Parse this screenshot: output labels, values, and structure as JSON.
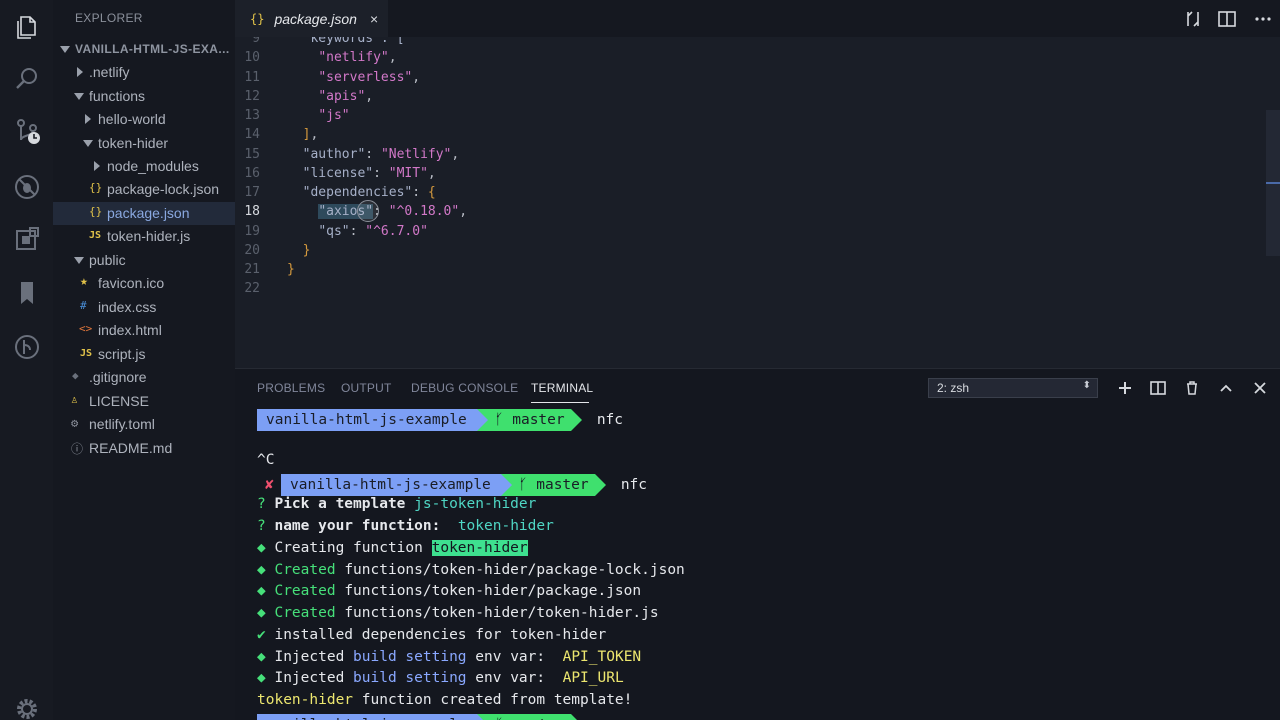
{
  "sidebar": {
    "title": "EXPLORER",
    "root": "VANILLA-HTML-JS-EXA...",
    "items": [
      {
        "label": ".netlify",
        "type": "folder",
        "state": "closed",
        "depth": 1
      },
      {
        "label": "functions",
        "type": "folder",
        "state": "open",
        "depth": 1
      },
      {
        "label": "hello-world",
        "type": "folder",
        "state": "closed",
        "depth": 2
      },
      {
        "label": "token-hider",
        "type": "folder",
        "state": "open",
        "depth": 2
      },
      {
        "label": "node_modules",
        "type": "folder",
        "state": "closed",
        "depth": 3
      },
      {
        "label": "package-lock.json",
        "type": "json",
        "depth": 3
      },
      {
        "label": "package.json",
        "type": "json",
        "depth": 3,
        "selected": true
      },
      {
        "label": "token-hider.js",
        "type": "js",
        "depth": 3
      },
      {
        "label": "public",
        "type": "folder",
        "state": "open",
        "depth": 1
      },
      {
        "label": "favicon.ico",
        "type": "ico",
        "depth": 2
      },
      {
        "label": "index.css",
        "type": "css",
        "depth": 2
      },
      {
        "label": "index.html",
        "type": "html",
        "depth": 2
      },
      {
        "label": "script.js",
        "type": "js",
        "depth": 2
      },
      {
        "label": ".gitignore",
        "type": "git",
        "depth": 1
      },
      {
        "label": "LICENSE",
        "type": "license",
        "depth": 1
      },
      {
        "label": "netlify.toml",
        "type": "toml",
        "depth": 1
      },
      {
        "label": "README.md",
        "type": "md",
        "depth": 1
      }
    ]
  },
  "editor": {
    "tab_icon": "{}",
    "tab_label": "package.json",
    "tab_close": "×",
    "lines": [
      {
        "n": "9",
        "code": "  \"keywords\": ["
      },
      {
        "n": "10",
        "code": "    \"netlify\","
      },
      {
        "n": "11",
        "code": "    \"serverless\","
      },
      {
        "n": "12",
        "code": "    \"apis\","
      },
      {
        "n": "13",
        "code": "    \"js\""
      },
      {
        "n": "14",
        "code": "  ],"
      },
      {
        "n": "15",
        "code": "  \"author\": \"Netlify\","
      },
      {
        "n": "16",
        "code": "  \"license\": \"MIT\","
      },
      {
        "n": "17",
        "code": "  \"dependencies\": {"
      },
      {
        "n": "18",
        "code": "    \"axios\": \"^0.18.0\","
      },
      {
        "n": "19",
        "code": "    \"qs\": \"^6.7.0\""
      },
      {
        "n": "20",
        "code": "  }"
      },
      {
        "n": "21",
        "code": "}"
      },
      {
        "n": "22",
        "code": ""
      }
    ]
  },
  "panel": {
    "tabs": [
      "PROBLEMS",
      "OUTPUT",
      "DEBUG CONSOLE",
      "TERMINAL"
    ],
    "active_tab": "TERMINAL",
    "shell_select": "2: zsh",
    "prompt_path": "vanilla-html-js-example",
    "prompt_branch": "master",
    "cmd": "nfc",
    "ctrl_c": "^C",
    "err_mark": "✘",
    "q_mark": "?",
    "pick_label": "Pick a template",
    "pick_value": "js-token-hider",
    "name_label": "name your function:",
    "name_value": "token-hider",
    "diamond": "◆",
    "creating": "Creating function",
    "created": "Created",
    "file1": "functions/token-hider/package-lock.json",
    "file2": "functions/token-hider/package.json",
    "file3": "functions/token-hider/token-hider.js",
    "check": "✔",
    "installed": "installed dependencies for token-hider",
    "injected": "Injected",
    "build_setting": "build setting",
    "env_var": "env var:",
    "api_token": "API_TOKEN",
    "api_url": "API_URL",
    "created_from": "function created from template!",
    "fn_name": "token-hider"
  },
  "colors": {
    "accent": "#7c9ff5",
    "git_branch": "#3fe06e",
    "string": "#d278c8"
  }
}
